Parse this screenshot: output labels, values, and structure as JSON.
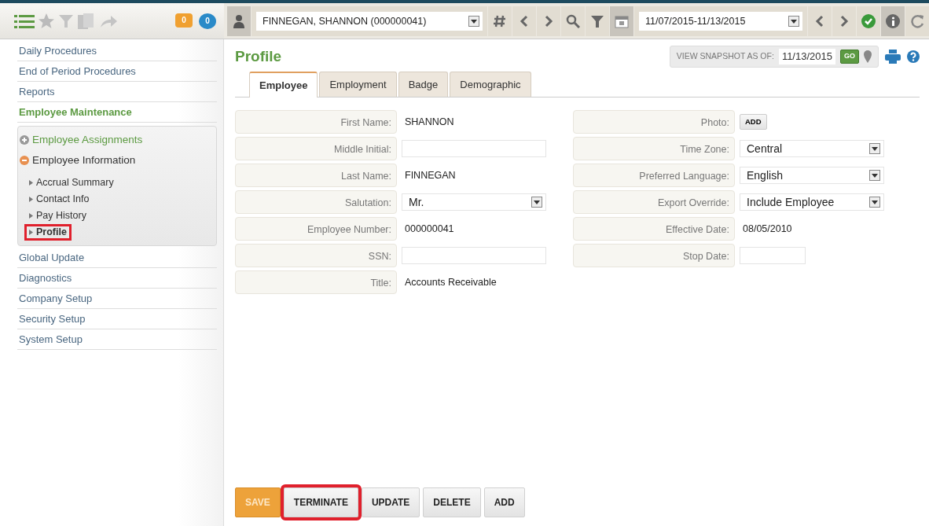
{
  "toolbar": {
    "badges": [
      {
        "text": "0",
        "color": "#f0a030"
      },
      {
        "text": "0",
        "color": "#2a8ac8"
      }
    ],
    "employee": {
      "value": "FINNEGAN, SHANNON (000000041)"
    },
    "period": {
      "value": "11/07/2015-11/13/2015"
    }
  },
  "sidebar": {
    "items": [
      {
        "label": "Daily Procedures",
        "kind": "link"
      },
      {
        "label": "End of Period Procedures",
        "kind": "link"
      },
      {
        "label": "Reports",
        "kind": "link"
      },
      {
        "label": "Employee Maintenance",
        "kind": "group",
        "expanded": true,
        "children": [
          {
            "label": "Employee Assignments",
            "expanded": false
          },
          {
            "label": "Employee Information",
            "expanded": true,
            "children": [
              {
                "label": "Accrual Summary",
                "selected": false,
                "highlighted": false
              },
              {
                "label": "Contact Info",
                "selected": false,
                "highlighted": false
              },
              {
                "label": "Pay History",
                "selected": false,
                "highlighted": false
              },
              {
                "label": "Profile",
                "selected": true,
                "highlighted": true
              }
            ]
          }
        ]
      },
      {
        "label": "Global Update",
        "kind": "link"
      },
      {
        "label": "Diagnostics",
        "kind": "link"
      },
      {
        "label": "Company Setup",
        "kind": "link"
      },
      {
        "label": "Security Setup",
        "kind": "link"
      },
      {
        "label": "System Setup",
        "kind": "link"
      }
    ]
  },
  "page": {
    "title": "Profile",
    "snapshot": {
      "label": "VIEW SNAPSHOT AS OF:",
      "date": "11/13/2015",
      "button": "GO"
    }
  },
  "tabs": [
    {
      "label": "Employee",
      "selected": true
    },
    {
      "label": "Employment",
      "selected": false
    },
    {
      "label": "Badge",
      "selected": false
    },
    {
      "label": "Demographic",
      "selected": false
    }
  ],
  "form": {
    "left": [
      {
        "label": "First Name:",
        "kind": "text",
        "value": "SHANNON"
      },
      {
        "label": "Middle Initial:",
        "kind": "input"
      },
      {
        "label": "Last Name:",
        "kind": "text",
        "value": "FINNEGAN"
      },
      {
        "label": "Salutation:",
        "kind": "select",
        "value": "Mr."
      },
      {
        "label": "Employee Number:",
        "kind": "text",
        "value": "000000041"
      },
      {
        "label": "SSN:",
        "kind": "input"
      },
      {
        "label": "Title:",
        "kind": "text",
        "value": "Accounts Receivable"
      }
    ],
    "right": [
      {
        "label": "Photo:",
        "kind": "button",
        "value": "ADD"
      },
      {
        "label": "Time Zone:",
        "kind": "select",
        "value": "Central"
      },
      {
        "label": "Preferred Language:",
        "kind": "select",
        "value": "English"
      },
      {
        "label": "Export Override:",
        "kind": "select",
        "value": "Include Employee"
      },
      {
        "label": "Effective Date:",
        "kind": "text",
        "value": "08/05/2010"
      },
      {
        "label": "Stop Date:",
        "kind": "shortinput"
      }
    ]
  },
  "buttons": [
    {
      "label": "SAVE",
      "kind": "primary",
      "highlighted": false
    },
    {
      "label": "TERMINATE",
      "kind": "default",
      "highlighted": true
    },
    {
      "label": "UPDATE",
      "kind": "default",
      "highlighted": false
    },
    {
      "label": "DELETE",
      "kind": "default",
      "highlighted": false
    },
    {
      "label": "ADD",
      "kind": "default",
      "highlighted": false
    }
  ]
}
